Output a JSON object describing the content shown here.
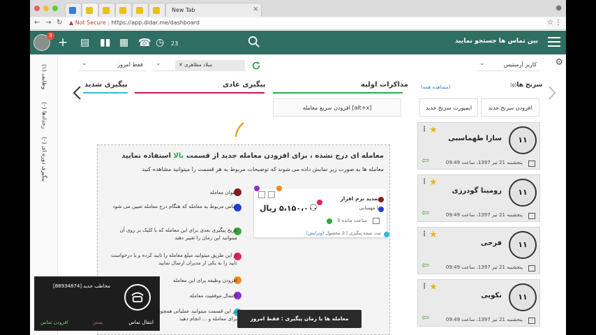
{
  "browser": {
    "tabs": [
      {
        "label": ""
      },
      {
        "label": ""
      },
      {
        "label": ""
      },
      {
        "label": ""
      },
      {
        "label": ""
      }
    ],
    "new_tab_label": "New Tab",
    "security": "Not Secure",
    "url": "https://app.didar.me/dashboard"
  },
  "header": {
    "notification_count": "3",
    "reminder_count": "23",
    "search_placeholder": "بین تماس ها جستجو نمایید"
  },
  "sidebar": {
    "items": [
      {
        "label": "وظایف (۱)"
      },
      {
        "label": "رخدادها (۰)"
      },
      {
        "label": "پیگیری دوره ای (۰)"
      }
    ]
  },
  "filters": {
    "period": "فقط امروز",
    "date_type": "میلاد مظاهری",
    "pipeline": "کاریز آرمیتیس"
  },
  "columns": {
    "intense": "پیگیری شدید",
    "normal": "پیگیری عادی",
    "initial": "مذاکرات اولیه",
    "leads": "سرنخ ها",
    "leads_count": "(۵)",
    "view_all": "(مشاهده همه)"
  },
  "quick_add": "افزودن سریع معامله [alt+x]",
  "buttons": {
    "add_lead": "افزودن سرنخ جدید",
    "import_lead": "ایمپورت سرنخ جدید"
  },
  "help": {
    "title_pre": "معامله ای درج نشده ، برای افزودن معامله جدید از قسمت",
    "title_hl": "بالا",
    "title_post": "استفاده نمایید",
    "subtitle": "معامله ها به صورت زیر نمایش داده می شوند که توضیحات مربوط به هر قسمت را میتوانید مشاهده کنید",
    "legend": [
      {
        "text": "عنوان معامله",
        "color": "#8b1a1a"
      },
      {
        "text": "تماس مربوط به معامله که هنگام درج معامله تعیین می شود",
        "color": "#1f3fd6"
      },
      {
        "text": "تاریخ پیگیری بعدی برای این معامله که با کلیک بر روی آن میتوانید این زمان را تغییر دهید",
        "color": "#36a63a"
      },
      {
        "text": "از این طریق میتوانید مبلغ معامله را تایید کرده و یا درخواست تایید را به یکی از مدیران ارسال نمایید",
        "color": "#e0206a"
      },
      {
        "text": "افزودن وظیفه برای این معامله",
        "color": "#f08a1c"
      },
      {
        "text": "احتمال موفقیت معامله",
        "color": "#8e2bd0"
      },
      {
        "text": "در این قسمت میتوانید عملیاتی همچون معامله،افزودن محصول برای معامله و ... انجام دهید",
        "color": "#35b8e0"
      }
    ],
    "sample": {
      "title": "تمدید نرم افزار",
      "contact": "با مهسایی",
      "price": "۵،۱۵۰،۰۰۰ ریال",
      "time_left": "3 ساعت مانده",
      "footer_pre": "ثبت نتیجه پیگیری",
      "footer_mid": "2 محصول",
      "footer_link": "(ویرایش)"
    }
  },
  "leads": [
    {
      "name": "سارا طهماسبی",
      "date": "پنجشنبه 21 تیر 1397، ساعت 09:49",
      "avatar": "۱۱"
    },
    {
      "name": "رومینا گودرزی",
      "date": "پنجشنبه 21 تیر 1397، ساعت 09:49",
      "avatar": "۱۱"
    },
    {
      "name": "فرحی",
      "date": "پنجشنبه 21 تیر 1397، ساعت 09:49",
      "avatar": "۱۱"
    },
    {
      "name": "نکویی",
      "date": "پنجشنبه 21 تیر 1397، ساعت 09:49",
      "avatar": "۱۱"
    }
  ],
  "call": {
    "title": "مخاطب جدید [88934874]",
    "transfer": "انتقال تماس",
    "close": "بستن",
    "add_contact": "افزودن تماس"
  },
  "toast": "معامله ها با زمان پیگیری : فقط امروز",
  "colors": {
    "header": "#2e6e63",
    "accent_green": "#2ea84a",
    "intense_line": "#3ab7d8",
    "normal_line": "#c2185b",
    "initial_line": "#2ea84a"
  }
}
